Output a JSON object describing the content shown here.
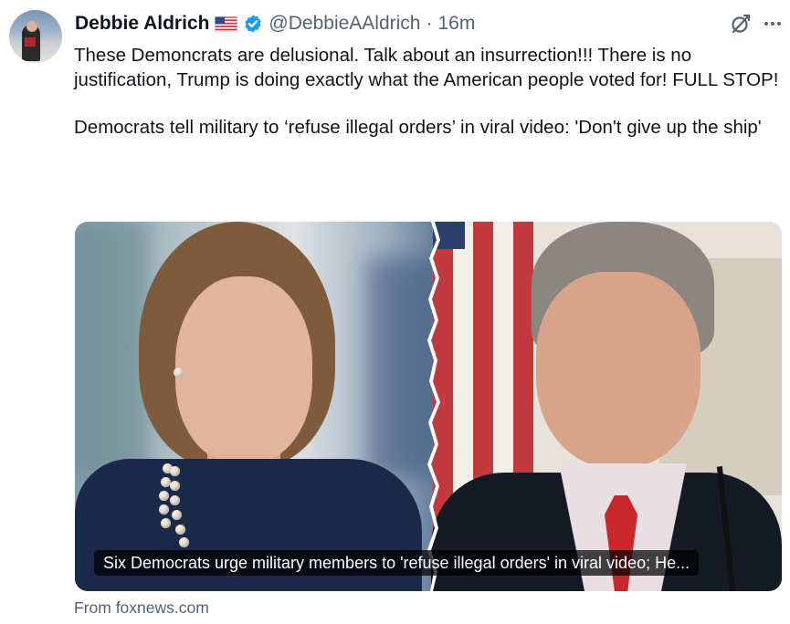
{
  "author": {
    "name": "Debbie Aldrich",
    "handle": "@DebbieAAldrich",
    "separator": "·",
    "time": "16m",
    "verified": true,
    "flag_icon": "us-flag-icon"
  },
  "tweet": {
    "paragraph1": "These Demoncrats are delusional.  Talk about an insurrection!!!  There is no justification, Trump is doing exactly what the American people voted for! FULL STOP!",
    "paragraph2": "Democrats tell military to ‘refuse illegal orders’ in viral video: 'Don't give up the ship'"
  },
  "card": {
    "caption": "Six Democrats urge military members to 'refuse illegal orders' in viral video; He...",
    "source": "From foxnews.com"
  },
  "icons": {
    "grok": "grok-icon",
    "more": "more-icon"
  },
  "colors": {
    "verified_blue": "#1d9bf0",
    "secondary_text": "#536471"
  }
}
